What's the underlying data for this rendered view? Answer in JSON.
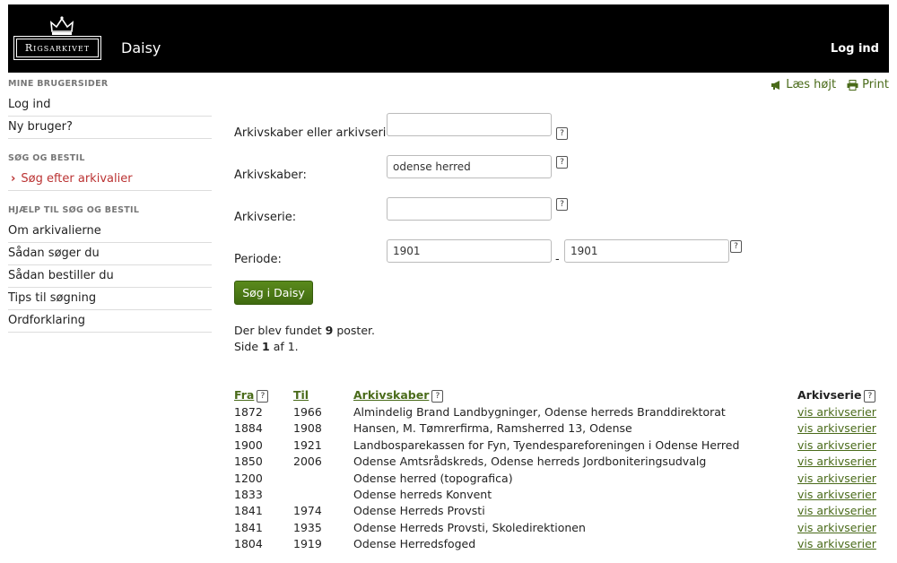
{
  "header": {
    "logo_text": "Rigsarkivet",
    "app_title": "Daisy",
    "login_label": "Log ind"
  },
  "tools": {
    "read_aloud": "Læs højt",
    "print": "Print"
  },
  "sidebar": {
    "sections": [
      {
        "heading": "Mine brugersider",
        "items": [
          "Log ind",
          "Ny bruger?"
        ]
      },
      {
        "heading": "Søg og bestil",
        "items": [
          "Søg efter arkivalier"
        ]
      },
      {
        "heading": "Hjælp til søg og bestil",
        "items": [
          "Om arkivalierne",
          "Sådan søger du",
          "Sådan bestiller du",
          "Tips til søgning",
          "Ordforklaring"
        ]
      }
    ]
  },
  "form": {
    "creator_or_series_label": "Arkivskaber eller arkivserie:",
    "creator_or_series_value": "",
    "creator_label": "Arkivskaber:",
    "creator_value": "odense herred",
    "series_label": "Arkivserie:",
    "series_value": "",
    "period_label": "Periode:",
    "period_from": "1901",
    "period_to": "1901",
    "period_separator": "-",
    "help_glyph": "?",
    "search_button": "Søg i Daisy"
  },
  "result": {
    "found_prefix": "Der blev fundet ",
    "found_count": "9",
    "found_suffix": " poster.",
    "page_prefix": "Side ",
    "page_current": "1",
    "page_suffix": " af 1."
  },
  "table": {
    "headers": {
      "from": "Fra",
      "to": "Til",
      "creator": "Arkivskaber",
      "series": "Arkivserie"
    },
    "rows": [
      {
        "from": "1872",
        "to": "1966",
        "creator": "Almindelig Brand Landbygninger, Odense herreds Branddirektorat",
        "link": "vis arkivserier"
      },
      {
        "from": "1884",
        "to": "1908",
        "creator": "Hansen, M. Tømrerfirma, Ramsherred 13, Odense",
        "link": "vis arkivserier"
      },
      {
        "from": "1900",
        "to": "1921",
        "creator": "Landbosparekassen for Fyn, Tyendespareforeningen i Odense Herred",
        "link": "vis arkivserier"
      },
      {
        "from": "1850",
        "to": "2006",
        "creator": "Odense Amtsrådskreds, Odense herreds Jordboniteringsudvalg",
        "link": "vis arkivserier"
      },
      {
        "from": "1200",
        "to": "",
        "creator": "Odense herred (topografica)",
        "link": "vis arkivserier"
      },
      {
        "from": "1833",
        "to": "",
        "creator": "Odense herreds Konvent",
        "link": "vis arkivserier"
      },
      {
        "from": "1841",
        "to": "1974",
        "creator": "Odense Herreds Provsti",
        "link": "vis arkivserier"
      },
      {
        "from": "1841",
        "to": "1935",
        "creator": "Odense Herreds Provsti, Skoledirektionen",
        "link": "vis arkivserier"
      },
      {
        "from": "1804",
        "to": "1919",
        "creator": "Odense Herredsfoged",
        "link": "vis arkivserier"
      }
    ]
  }
}
